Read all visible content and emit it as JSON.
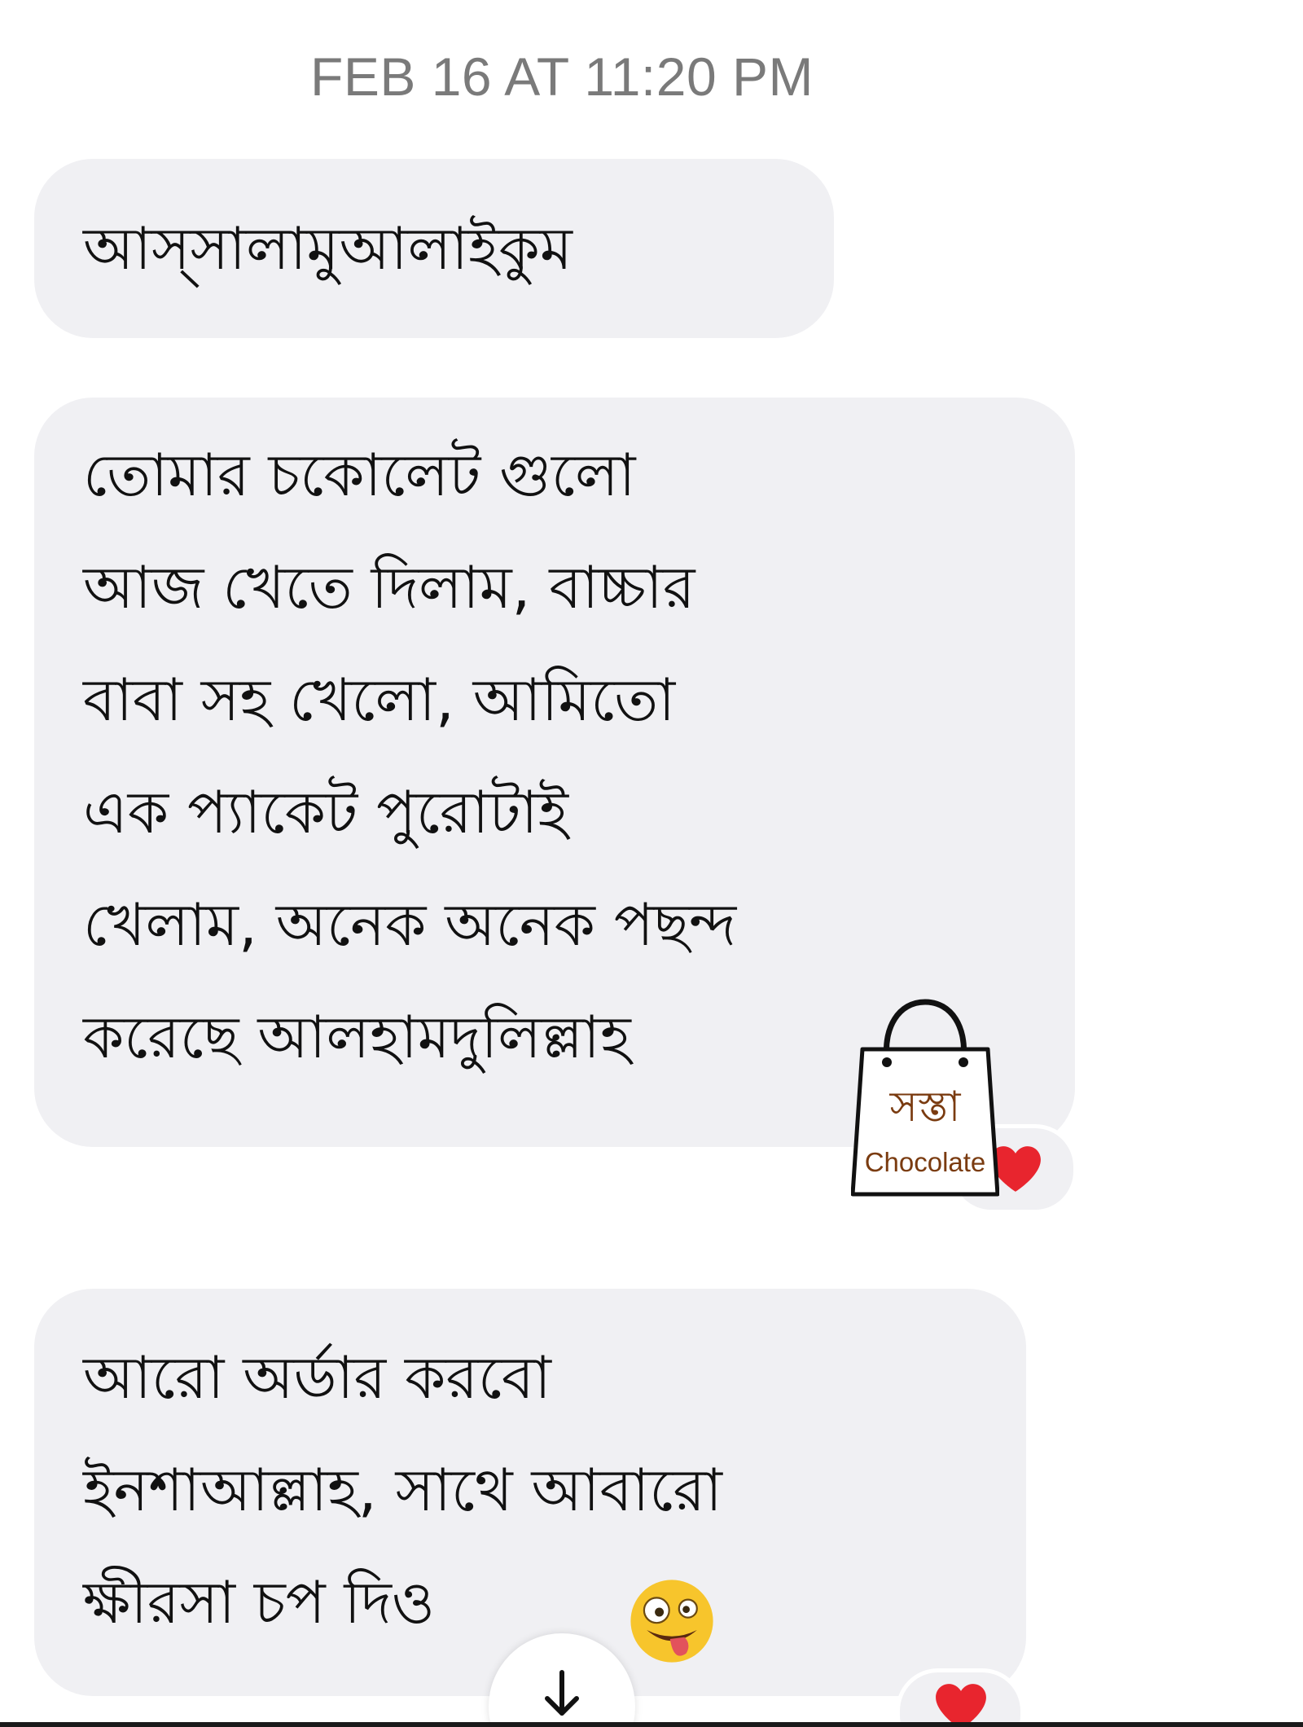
{
  "conversation": {
    "timestamp": "FEB 16 AT 11:20 PM",
    "messages": [
      {
        "lines": [
          "আস্সালামুআলাইকুম"
        ]
      },
      {
        "lines": [
          "তোমার চকোলেট গুলো",
          "আজ খেতে দিলাম, বাচ্চার",
          "বাবা সহ খেলো, আমিতো",
          "এক প্যাকেট পুরোটাই",
          "খেলাম, অনেক অনেক পছন্দ",
          "করেছে আলহামদুলিল্লাহ"
        ],
        "reaction": "heart-icon"
      },
      {
        "lines": [
          "আরো অর্ডার করবো",
          "ইনশাআল্লাহ, সাথে আবারো",
          "ক্ষীরসা চপ দিও"
        ],
        "emoji": "zany-face-emoji",
        "reaction": "heart-icon"
      }
    ]
  },
  "watermark": {
    "title": "সস্তা",
    "subtitle": "Chocolate"
  },
  "colors": {
    "bubble": "#f0f0f3",
    "timestamp": "#7a7a7a",
    "heart": "#e8252e",
    "logo_text": "#7a3b10"
  },
  "icons": {
    "scroll_down": "arrow-down-icon",
    "reaction": "heart-icon"
  }
}
